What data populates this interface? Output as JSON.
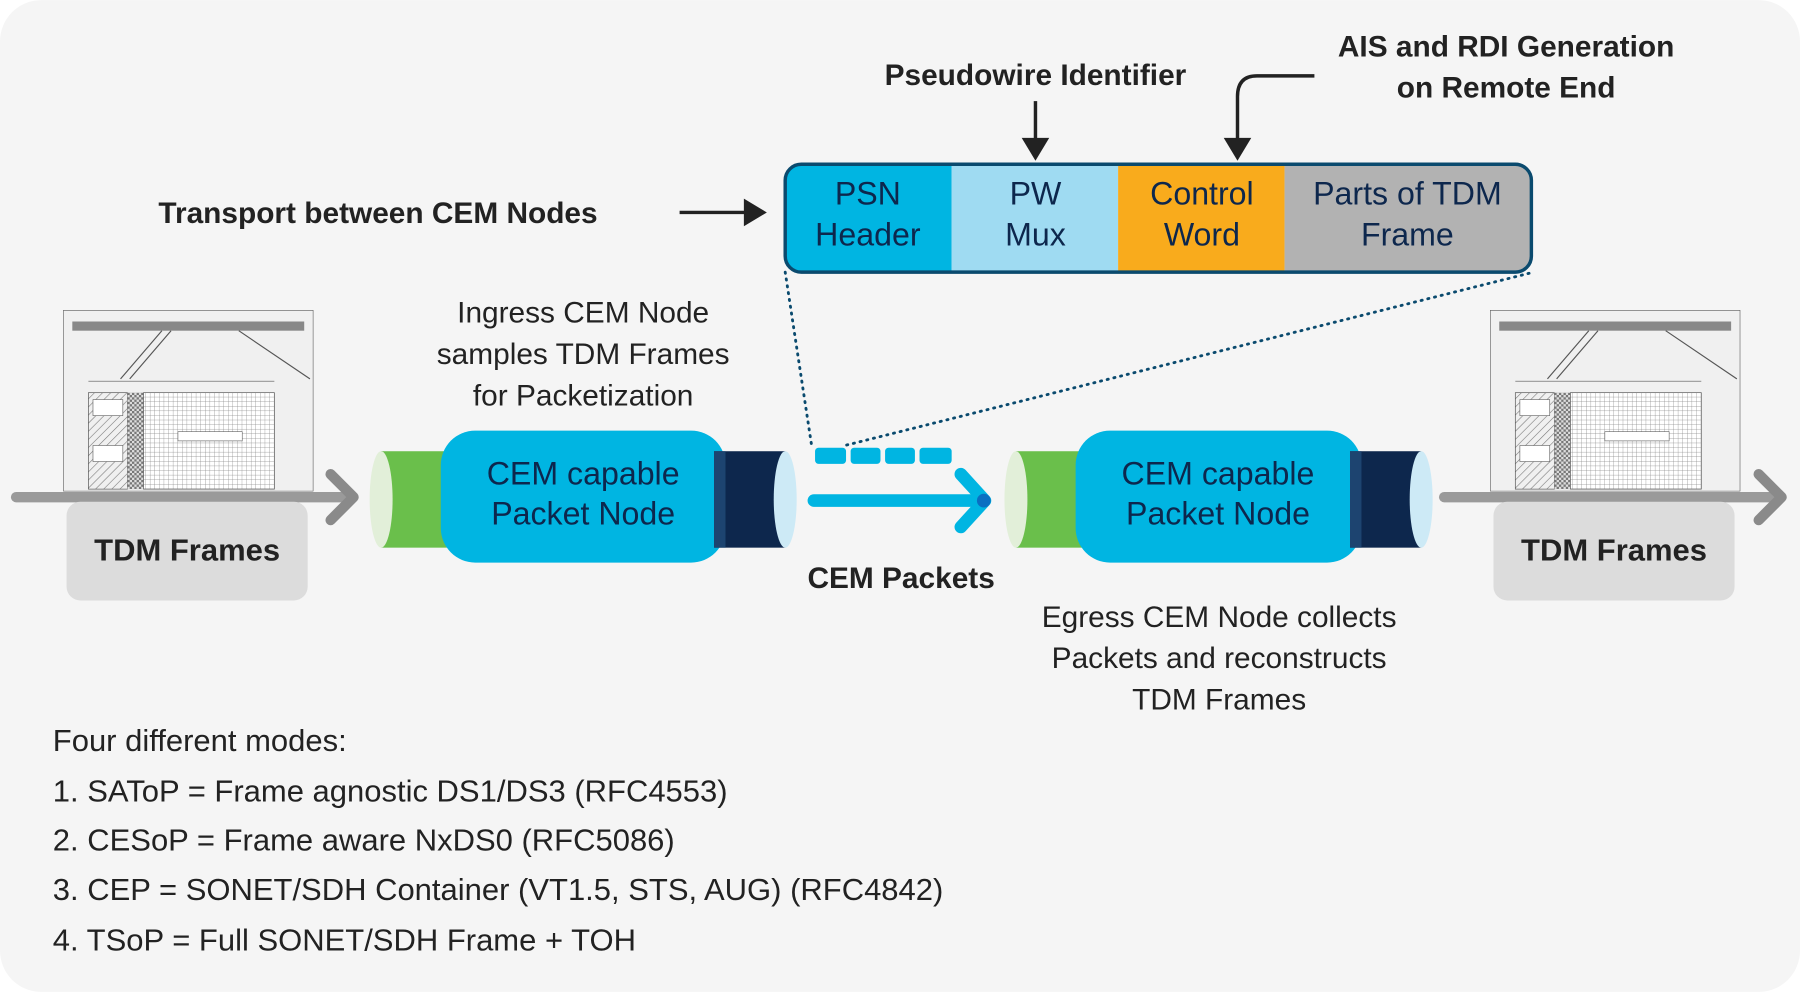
{
  "header_labels": {
    "pseudowire": "Pseudowire Identifier",
    "ais_line1": "AIS and RDI Generation",
    "ais_line2": "on Remote End",
    "transport": "Transport between CEM Nodes"
  },
  "packet_segments": [
    {
      "line1": "PSN",
      "line2": "Header",
      "color": "#00b5e2"
    },
    {
      "line1": "PW",
      "line2": "Mux",
      "color": "#9fdbf2"
    },
    {
      "line1": "Control",
      "line2": "Word",
      "color": "#f9ab1c"
    },
    {
      "line1": "Parts of TDM",
      "line2": "Frame",
      "color": "#b2b2b2"
    }
  ],
  "ingress": {
    "lines": [
      "Ingress CEM Node",
      "samples TDM Frames",
      "for Packetization"
    ]
  },
  "egress": {
    "lines": [
      "Egress CEM Node collects",
      "Packets and reconstructs",
      "TDM Frames"
    ]
  },
  "nodes": [
    {
      "line1": "CEM capable",
      "line2": "Packet Node"
    },
    {
      "line1": "CEM capable",
      "line2": "Packet Node"
    }
  ],
  "cem_packets_label": "CEM Packets",
  "tdm_frames": [
    "TDM Frames",
    "TDM Frames"
  ],
  "modes": {
    "title": "Four different modes:",
    "items": [
      "1. SAToP = Frame agnostic DS1/DS3 (RFC4553)",
      "2. CESoP = Frame aware NxDS0 (RFC5086)",
      "3. CEP = SONET/SDH Container (VT1.5, STS, AUG) (RFC4842)",
      "4. TSoP = Full SONET/SDH Frame + TOH"
    ]
  },
  "colors": {
    "navy": "#0d274d",
    "cyan": "#00b5e2",
    "green": "#6abf4b",
    "orange": "#f9ab1c",
    "gray": "#b2b2b2"
  }
}
